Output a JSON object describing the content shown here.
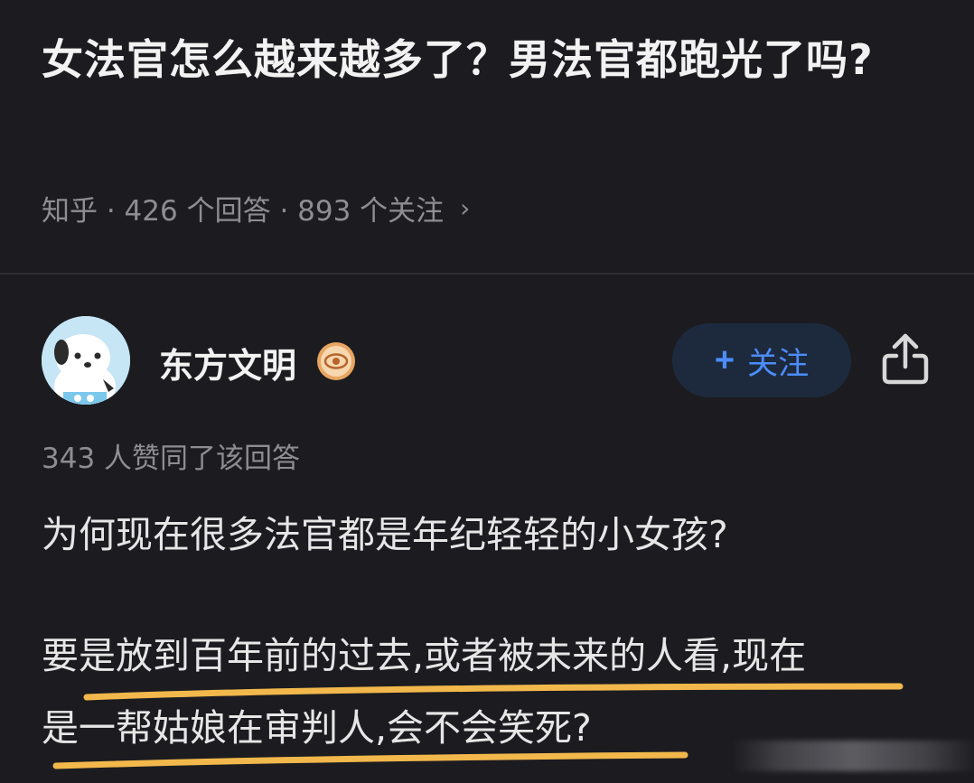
{
  "question": {
    "title": "女法官怎么越来越多了？男法官都跑光了吗?",
    "meta": "知乎 · 426 个回答 · 893 个关注",
    "chevron": "›"
  },
  "author": {
    "name": "东方文明",
    "avatar_icon": "dog-avatar-icon",
    "badge_icon": "eye-badge-icon",
    "follow_plus": "+",
    "follow_label": "关注",
    "share_icon": "share-icon"
  },
  "answer": {
    "likes": "343 人赞同了该回答",
    "line1": "为何现在很多法官都是年纪轻轻的小女孩?",
    "line2": "要是放到百年前的过去,或者被未来的人看,现在",
    "line3": "是一帮姑娘在审判人,会不会笑死?"
  },
  "colors": {
    "background": "#1c1c20",
    "accent": "#4c8dfa",
    "highlight": "#f2b84b"
  }
}
